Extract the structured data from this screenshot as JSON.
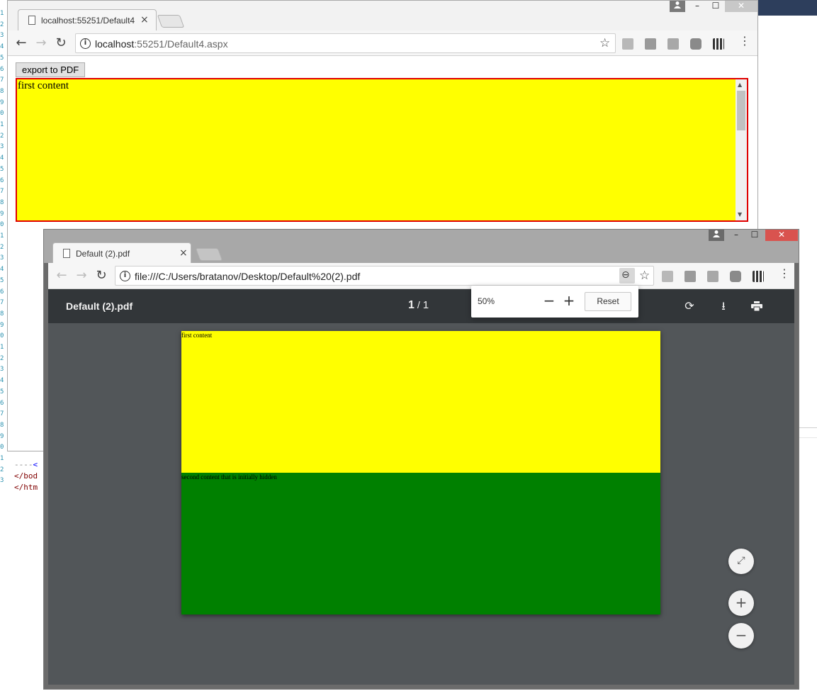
{
  "editor": {
    "gutter_numbers": [
      "1",
      "2",
      "3",
      "4",
      "5",
      "6",
      "7",
      "8",
      "9",
      "0",
      "1",
      "2",
      "3",
      "4",
      "5",
      "6",
      "7",
      "8",
      "9",
      "0",
      "1",
      "2",
      "3",
      "4",
      "5",
      "6",
      "7",
      "8",
      "9",
      "0",
      "1",
      "2",
      "3",
      "4",
      "5",
      "6",
      "7",
      "8",
      "9",
      "0",
      "1",
      "2",
      "3"
    ],
    "code_lines": [
      {
        "prefix": "----",
        "tag": "<"
      },
      {
        "prefix": "",
        "tag": "</bod"
      },
      {
        "prefix": "",
        "tag": "</htm"
      }
    ]
  },
  "window1": {
    "tab_title": "localhost:55251/Default4",
    "tab_close": "×",
    "address_host": "localhost",
    "address_rest": ":55251/Default4.aspx",
    "export_button": "export to PDF",
    "box_text": "first content",
    "controls": {
      "minimize": "–",
      "maximize": "☐",
      "close": "✕"
    }
  },
  "window2": {
    "tab_title": "Default (2).pdf",
    "tab_close": "×",
    "address": "file:///C:/Users/bratanov/Desktop/Default%20(2).pdf",
    "controls": {
      "minimize": "–",
      "maximize": "☐",
      "close": "✕"
    },
    "pdf": {
      "file_title": "Default (2).pdf",
      "current_page": "1",
      "page_separator": "/",
      "total_pages": "1",
      "block1_text": "first content",
      "block2_text": "second content that is initially hidden"
    },
    "zoom_popup": {
      "value": "50%",
      "minus": "−",
      "plus": "+",
      "reset": "Reset"
    },
    "fabs": {
      "fit": "⤢",
      "zoom_in": "+",
      "zoom_out": "−"
    }
  },
  "colors": {
    "yellow": "#ffff00",
    "green": "#008000",
    "red_border": "#e00000",
    "pdf_toolbar": "#323639",
    "pdf_canvas": "#525659",
    "close_red": "#d9534f"
  },
  "icons": [
    "back-icon",
    "forward-icon",
    "reload-icon",
    "info-icon",
    "star-icon",
    "menu-icon",
    "document-icon",
    "rotate-icon",
    "download-icon",
    "print-icon",
    "zoom-out-icon",
    "fit-page-icon",
    "zoom-in-icon"
  ]
}
